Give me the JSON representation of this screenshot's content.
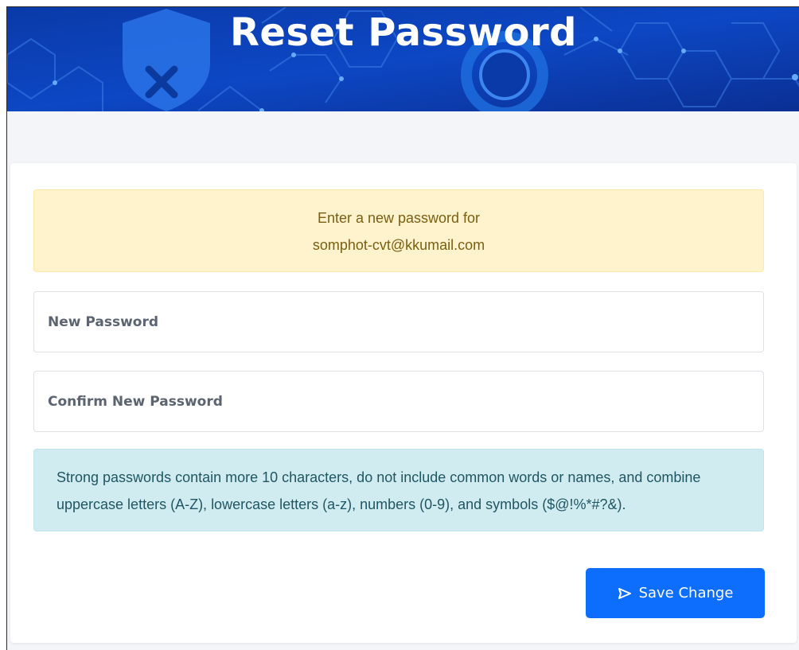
{
  "banner": {
    "title": "Reset Password",
    "icons": [
      "shield-x-icon",
      "lock-ring-icon"
    ],
    "colors": {
      "primary": "#0a3aa8",
      "accent": "#1f7be6"
    }
  },
  "notice": {
    "line1": "Enter a new password for",
    "email": "somphot-cvt@kkumail.com"
  },
  "form": {
    "new_password_placeholder": "New Password",
    "confirm_password_placeholder": "Confirm New Password"
  },
  "hint": {
    "text": "Strong passwords contain more 10 characters, do not include common words or names, and combine uppercase letters (A-Z), lowercase letters (a-z), numbers (0-9), and symbols ($@!%*#?&)."
  },
  "actions": {
    "save_label": "Save Change",
    "save_icon": "send-icon",
    "save_color": "#0d6efd"
  }
}
